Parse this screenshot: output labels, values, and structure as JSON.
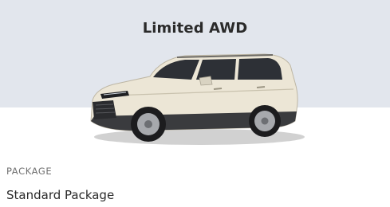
{
  "card": {
    "title": "Limited AWD",
    "package_label": "PACKAGE",
    "package_value": "Standard Package"
  },
  "colors": {
    "banner_bg": "#e2e6ed",
    "vehicle_paint": "#ece6d6",
    "text_primary": "#2a2a2a",
    "text_secondary": "#707070"
  },
  "icons": {
    "vehicle": "suv-vehicle-image"
  }
}
